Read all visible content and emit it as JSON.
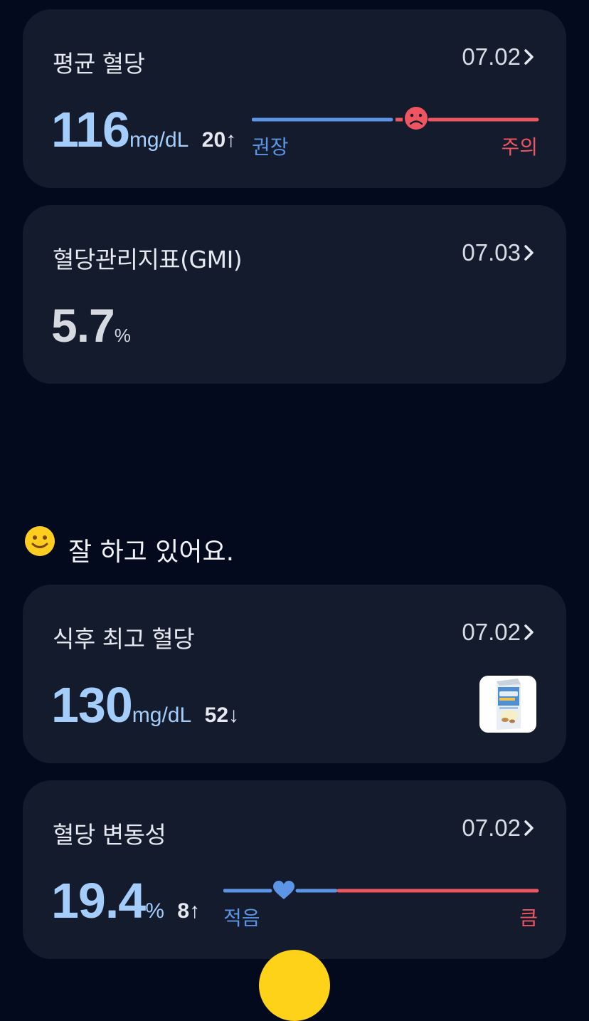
{
  "avg": {
    "title": "평균 혈당",
    "date": "07.02",
    "value": "116",
    "unit": "mg/dL",
    "delta": "20",
    "delta_arrow": "↑",
    "left_label": "권장",
    "right_label": "주의",
    "marker_icon": "sad-face-icon"
  },
  "gmi": {
    "title": "혈당관리지표(GMI)",
    "date": "07.03",
    "value": "5.7",
    "unit": "%"
  },
  "status": {
    "icon": "smile-face-icon",
    "text": "잘 하고 있어요."
  },
  "peak": {
    "title": "식후 최고 혈당",
    "date": "07.02",
    "value": "130",
    "unit": "mg/dL",
    "delta": "52",
    "delta_arrow": "↓",
    "thumbnail_icon": "almond-breeze-carton-icon"
  },
  "variability": {
    "title": "혈당 변동성",
    "date": "07.02",
    "value": "19.4",
    "unit": "%",
    "delta": "8",
    "delta_arrow": "↑",
    "left_label": "적음",
    "right_label": "큼",
    "marker_icon": "heart-icon"
  },
  "colors": {
    "background": "#030a1e",
    "card": "#131b2d",
    "value_blue": "#a4cdfb",
    "scale_blue": "#5c95e6",
    "scale_red": "#ef5560",
    "fab_yellow": "#ffd21a"
  }
}
